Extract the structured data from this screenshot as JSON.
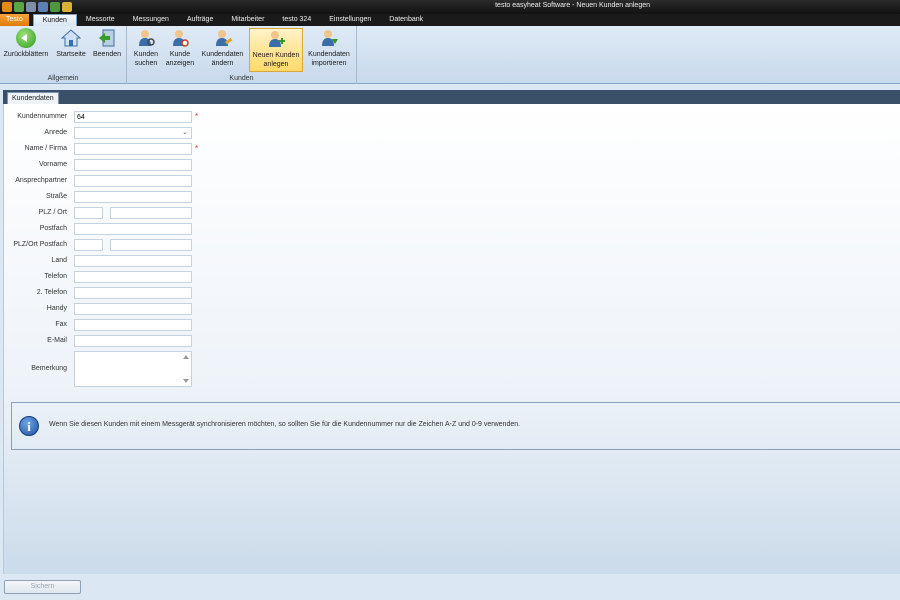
{
  "window": {
    "title": "testo easyheat Software - Neuen Kunden anlegen"
  },
  "tabs": [
    "Testo",
    "Kunden",
    "Messorte",
    "Messungen",
    "Aufträge",
    "Mitarbeiter",
    "testo 324",
    "Einstellungen",
    "Datenbank"
  ],
  "active_tab": "Kunden",
  "ribbon": {
    "groups": [
      {
        "label": "Allgemein",
        "buttons": [
          "Zurückblättern",
          "Startseite",
          "Beenden"
        ]
      },
      {
        "label": "Kunden",
        "buttons": [
          {
            "line1": "Kunden",
            "line2": "suchen"
          },
          {
            "line1": "Kunde",
            "line2": "anzeigen"
          },
          {
            "line1": "Kundendaten",
            "line2": "ändern"
          },
          {
            "line1": "Neuen Kunden",
            "line2": "anlegen"
          },
          {
            "line1": "Kundendaten",
            "line2": "importieren"
          }
        ]
      }
    ],
    "selected_button": "Neuen Kunden anlegen",
    "accent_color": "#ffd969"
  },
  "panel": {
    "tab_label": "Kundendaten"
  },
  "form": {
    "kundennummer": {
      "label": "Kundennummer",
      "value": "64",
      "required": "*"
    },
    "anrede": {
      "label": "Anrede",
      "value": ""
    },
    "name": {
      "label": "Name / Firma",
      "value": "",
      "required": "*"
    },
    "vorname": {
      "label": "Vorname",
      "value": ""
    },
    "ansprechpartner": {
      "label": "Ansprechpartner",
      "value": ""
    },
    "strasse": {
      "label": "Straße",
      "value": ""
    },
    "plz_ort": {
      "label": "PLZ / Ort",
      "plz": "",
      "ort": ""
    },
    "postfach": {
      "label": "Postfach",
      "value": ""
    },
    "plz_ort_postfach": {
      "label": "PLZ/Ort Postfach",
      "plz": "",
      "ort": ""
    },
    "land": {
      "label": "Land",
      "value": ""
    },
    "telefon": {
      "label": "Telefon",
      "value": ""
    },
    "telefon2": {
      "label": "2. Telefon",
      "value": ""
    },
    "handy": {
      "label": "Handy",
      "value": ""
    },
    "fax": {
      "label": "Fax",
      "value": ""
    },
    "email": {
      "label": "E-Mail",
      "value": ""
    },
    "bemerkung": {
      "label": "Bemerkung",
      "value": ""
    }
  },
  "info": {
    "icon": "info-icon",
    "message": "Wenn Sie diesen Kunden mit einem Messgerät synchronisieren möchten, so sollten Sie für die Kundennummer nur die Zeichen A-Z und 0-9 verwenden."
  },
  "footer": {
    "save_label": "Sichern"
  }
}
